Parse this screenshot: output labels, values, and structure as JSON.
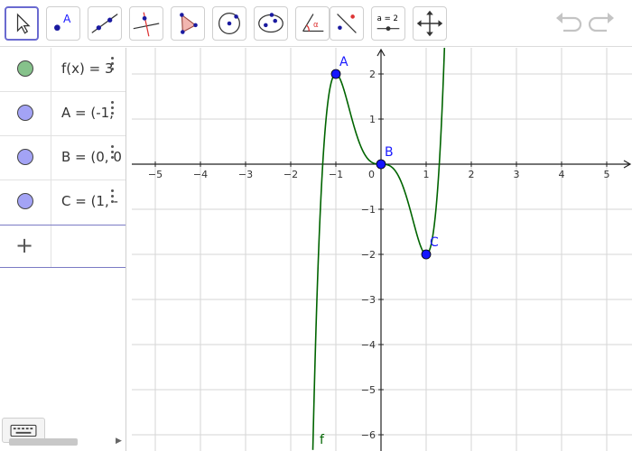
{
  "toolbar": {
    "tools": [
      {
        "id": "move",
        "icon": "cursor-arrow-icon",
        "active": true
      },
      {
        "id": "point",
        "icon": "point-icon",
        "label": "A"
      },
      {
        "id": "line",
        "icon": "line-through-points-icon"
      },
      {
        "id": "perpendicular",
        "icon": "perpendicular-line-icon"
      },
      {
        "id": "polygon",
        "icon": "polygon-icon"
      },
      {
        "id": "circle",
        "icon": "circle-center-point-icon"
      },
      {
        "id": "ellipse",
        "icon": "ellipse-icon"
      },
      {
        "id": "angle",
        "icon": "angle-icon"
      },
      {
        "id": "reflect",
        "icon": "reflect-about-line-icon"
      },
      {
        "id": "slider",
        "icon": "slider-icon",
        "label": "a = 2"
      },
      {
        "id": "move-graphics",
        "icon": "move-graphics-view-icon"
      }
    ],
    "undo_icon": "undo-icon",
    "redo_icon": "redo-icon"
  },
  "algebra": {
    "rows": [
      {
        "text": "f(x) = 3",
        "color": "#86c28b"
      },
      {
        "text": "A = (-1,",
        "color": "#a3a3f5"
      },
      {
        "text": "B = (0, 0",
        "color": "#a3a3f5"
      },
      {
        "text": "C = (1, -",
        "color": "#a3a3f5"
      }
    ],
    "add_label": "+"
  },
  "graph": {
    "x_ticks": [
      "−5",
      "−4",
      "−3",
      "−2",
      "−1",
      "1",
      "2",
      "3",
      "4",
      "5"
    ],
    "y_ticks_pos": [
      "2",
      "1"
    ],
    "y_ticks_neg": [
      "−1",
      "−2",
      "−3",
      "−4",
      "−5",
      "−6"
    ],
    "origin_label": "0",
    "function_label": "f",
    "function_color": "#006400",
    "point_color": "#1515ff",
    "points": [
      {
        "name": "A",
        "x": -1,
        "y": 2
      },
      {
        "name": "B",
        "x": 0,
        "y": 0
      },
      {
        "name": "C",
        "x": 1,
        "y": -2
      }
    ]
  }
}
